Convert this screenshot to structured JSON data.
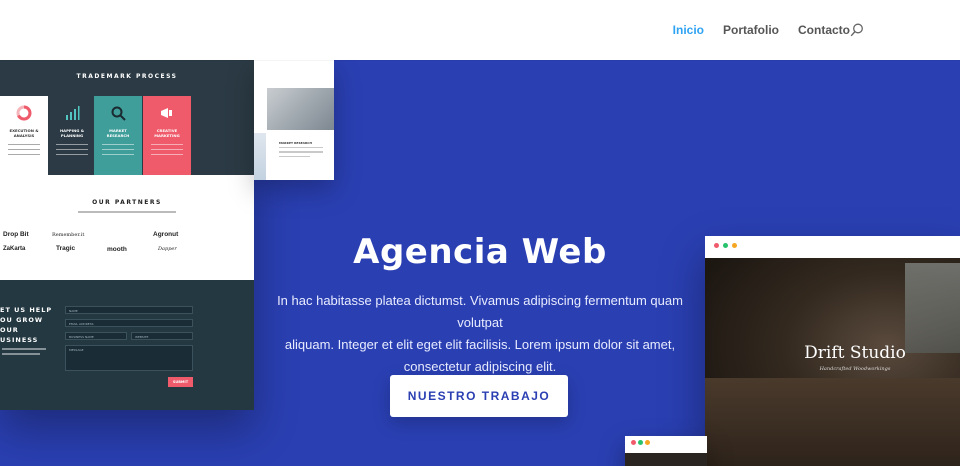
{
  "nav": {
    "items": [
      {
        "label": "Inicio",
        "active": true
      },
      {
        "label": "Portafolio",
        "active": false
      },
      {
        "label": "Contacto",
        "active": false
      }
    ],
    "search_icon": "search-icon"
  },
  "hero": {
    "title": "Agencia Web",
    "text_line1": "In hac habitasse platea dictumst. Vivamus adipiscing fermentum quam volutpat",
    "text_line2": "aliquam. Integer et elit eget elit facilisis. Lorem ipsum dolor sit amet,",
    "text_line3": "consectetur adipiscing elit.",
    "button": "NUESTRO TRABAJO",
    "background_color": "#2a3fb2"
  },
  "mockup_left": {
    "trademark_title": "TRADEMARK PROCESS",
    "cards": [
      {
        "label1": "EXECUTION &",
        "label2": "ANALYSIS",
        "color": "#ffffff"
      },
      {
        "label1": "HAPPING &",
        "label2": "PLANNING",
        "color": "#2b3a44"
      },
      {
        "label1": "MARKET",
        "label2": "RESEARCH",
        "color": "#3f9e9a"
      },
      {
        "label1": "CREATIVE",
        "label2": "MARKETING",
        "color": "#ef5b6b"
      }
    ],
    "partners_title": "OUR PARTNERS",
    "partners": [
      "Drop Bit",
      "Remember.it",
      "Agronut",
      "ZaKarta",
      "Tragic",
      "mooth",
      "Dapper"
    ],
    "contact_head_1": "ET US HELP",
    "contact_head_2": "OU GROW",
    "contact_head_3": "OUR",
    "contact_head_4": "USINESS",
    "fields": [
      "NAME",
      "EMAIL ADDRESS",
      "BUSINESS NAME",
      "WEBSITE",
      "MESSAGE"
    ],
    "submit": "SUBMIT"
  },
  "mockup_top": {
    "caption": "MARKET RESEARCH"
  },
  "mockup_right": {
    "title": "Drift Studio",
    "subtitle": "Handcrafted Woodworkings"
  }
}
